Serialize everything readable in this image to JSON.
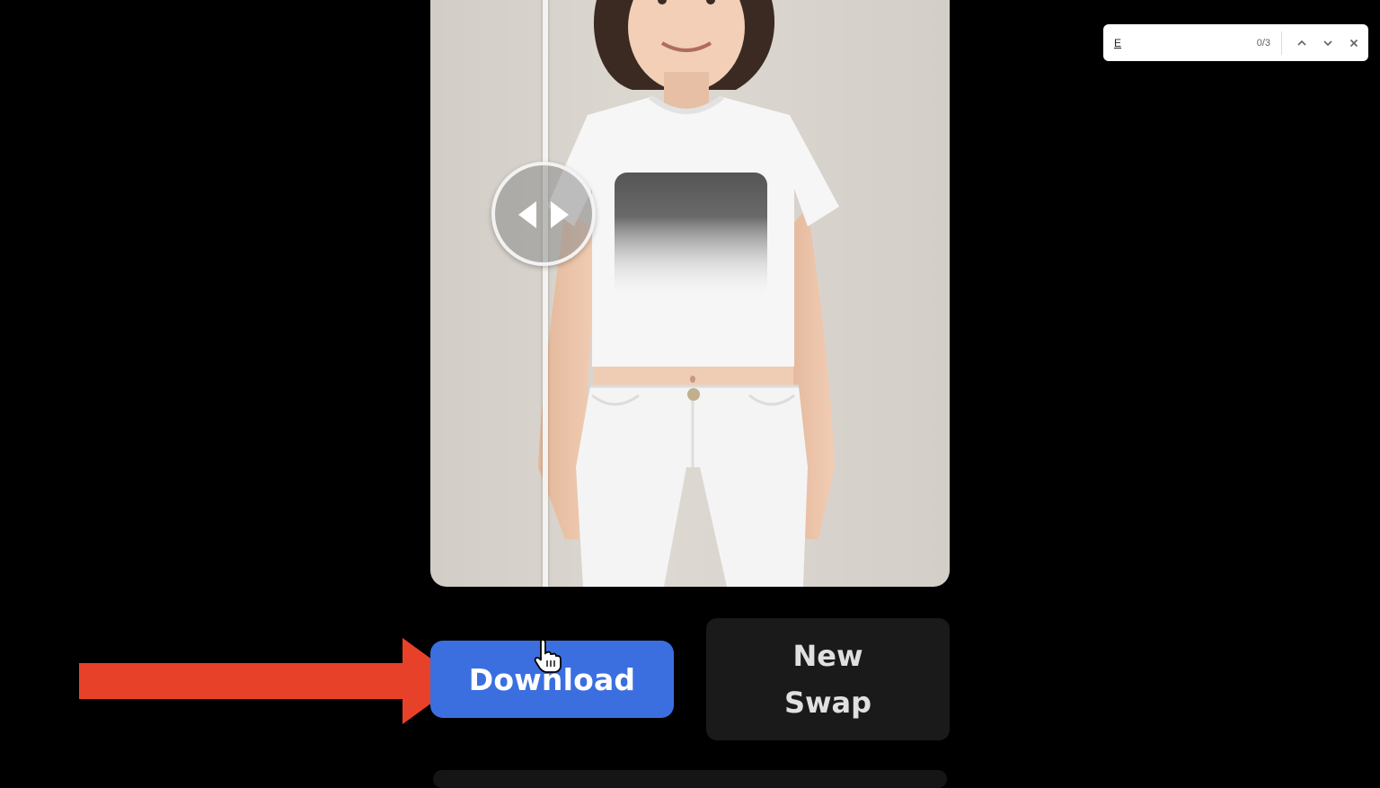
{
  "find_bar": {
    "query": "E",
    "match_count": "0/3",
    "prev_icon": "chevron-up-icon",
    "next_icon": "chevron-down-icon",
    "close_icon": "close-icon"
  },
  "compare_handle_icon": "left-right-arrows-icon",
  "buttons": {
    "download": "Download",
    "new_swap": "New Swap"
  },
  "colors": {
    "background": "#000000",
    "download_button": "#3b6fe0",
    "new_swap_button": "#1a1a1a",
    "annotation_arrow": "#e8412a"
  }
}
